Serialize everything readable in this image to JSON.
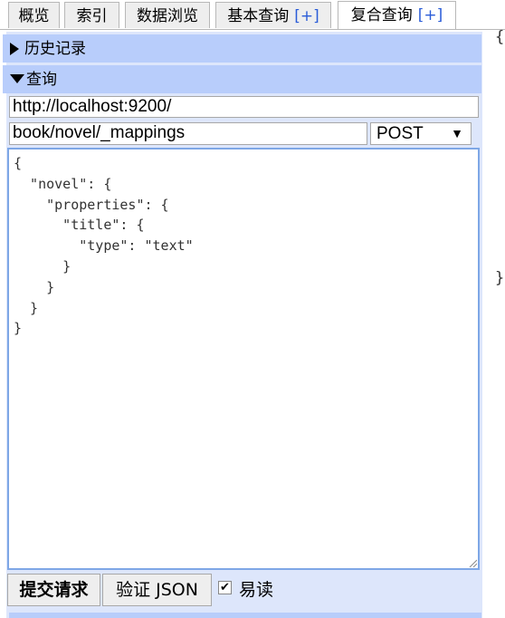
{
  "tabs": [
    {
      "label": "概览"
    },
    {
      "label": "索引"
    },
    {
      "label": "数据浏览"
    },
    {
      "label": "基本查询",
      "plus": "[+]"
    },
    {
      "label": "复合查询",
      "plus": "[+]",
      "active": true
    }
  ],
  "history": {
    "title": "历史记录"
  },
  "query": {
    "title": "查询",
    "url": "http://localhost:9200/",
    "path": "book/novel/_mappings",
    "method": "POST",
    "method_caret": "▼",
    "body": "{\n  \"novel\": {\n    \"properties\": {\n      \"title\": {\n        \"type\": \"text\"\n      }\n    }\n  }\n}"
  },
  "actions": {
    "submit": "提交请求",
    "validate": "验证 JSON",
    "pretty_checked": true,
    "pretty_label": "易读"
  },
  "results": {
    "open_brace": "{",
    "close_brace": "}"
  },
  "colors": {
    "panel_bg": "#dde6fb",
    "section_header": "#b8cdfb",
    "editor_border": "#7ea7e6",
    "plus_link": "#2a5cd8"
  }
}
